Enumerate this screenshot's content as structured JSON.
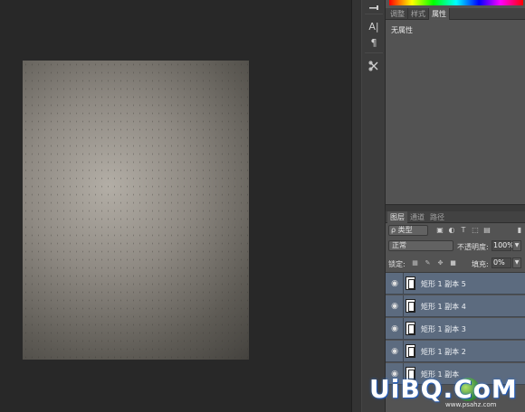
{
  "properties_panel": {
    "tabs": [
      {
        "label": "调整",
        "active": false
      },
      {
        "label": "样式",
        "active": false
      },
      {
        "label": "属性",
        "active": true
      }
    ],
    "empty_text": "无属性"
  },
  "tool_strip": {
    "tools": [
      "brush-icon",
      "character-icon",
      "paragraph-icon",
      "tool-presets-icon"
    ],
    "character_glyph": "A|",
    "paragraph_glyph": "¶"
  },
  "layers_panel": {
    "tabs": [
      {
        "label": "图层",
        "active": true
      },
      {
        "label": "通道",
        "active": false
      },
      {
        "label": "路径",
        "active": false
      }
    ],
    "filter_label": "ρ 类型",
    "blend_mode": "正常",
    "opacity_label": "不透明度:",
    "opacity_value": "100%",
    "lock_label": "锁定:",
    "fill_label": "填充:",
    "fill_value": "0%",
    "layers": [
      {
        "name": "矩形 1 副本 5",
        "selected": true,
        "visible": true
      },
      {
        "name": "矩形 1 副本 4",
        "selected": true,
        "visible": true
      },
      {
        "name": "矩形 1 副本 3",
        "selected": true,
        "visible": true
      },
      {
        "name": "矩形 1 副本 2",
        "selected": true,
        "visible": true
      },
      {
        "name": "矩形 1 副本",
        "selected": true,
        "visible": true
      }
    ]
  },
  "watermark": {
    "text": "UiBQ.CoM",
    "subtext": "www.psahz.com"
  },
  "colors": {
    "canvas_bg": "#282828",
    "panel_bg": "#535353",
    "selected_layer": "#5c6b7f"
  }
}
